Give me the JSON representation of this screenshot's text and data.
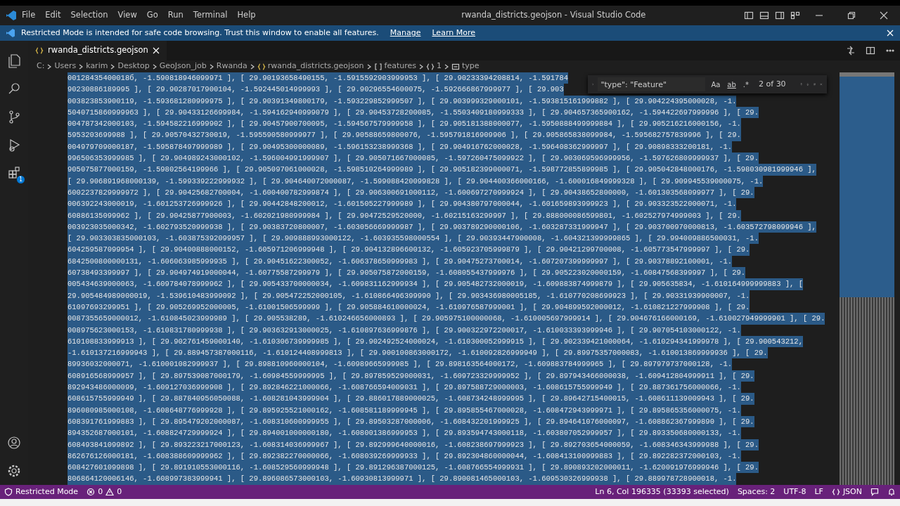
{
  "window": {
    "title": "rwanda_districts.geojson - Visual Studio Code"
  },
  "menu": [
    "File",
    "Edit",
    "Selection",
    "View",
    "Go",
    "Run",
    "Terminal",
    "Help"
  ],
  "banner": {
    "text": "Restricted Mode is intended for safe code browsing. Trust this window to enable all features.",
    "links": [
      "Manage",
      "Learn More"
    ]
  },
  "activity_bar": {
    "extensions_badge": "1"
  },
  "tabs": [
    {
      "label": "rwanda_districts.geojson",
      "selected": true
    }
  ],
  "breadcrumb": [
    {
      "label": "C:",
      "kind": "folder"
    },
    {
      "label": "Users",
      "kind": "folder"
    },
    {
      "label": "karim",
      "kind": "folder"
    },
    {
      "label": "Desktop",
      "kind": "folder"
    },
    {
      "label": "GeoJson_job",
      "kind": "folder"
    },
    {
      "label": "Rwanda",
      "kind": "folder"
    },
    {
      "label": "rwanda_districts.geojson",
      "kind": "file"
    },
    {
      "label": "features",
      "kind": "array"
    },
    {
      "label": "1",
      "kind": "object"
    },
    {
      "label": "type",
      "kind": "property"
    }
  ],
  "find": {
    "query": "\"type\": \"Feature\"",
    "options": [
      "Aa",
      "ab",
      ".*"
    ],
    "count": "2 of 30"
  },
  "editor": {
    "selected": true,
    "lines": [
      "00128435400018б, -1.590818946099971 ], [ 29.90193658490155, -1.5915592903999953 ], [ 29.90233394208814, -1.591784",
      "90230886189995 ], [ 29.90287017900104, -1.592445014999993 ], [ 29.90296554600075, -1.592666867999977 ], [ 29.903",
      "003823853900119, -1.593681280999975 ], [ 29.90391349800179, -1.593229852999507 ], [ 29.903999329000101, -1.593815161999882 ], [ 29.904224395000028, -1.",
      "5040715860999963 ], [ 29.90433126699984, -1.594162940999079 ], [ 29.90453728200085, -1.5503409180999333 ], [ 29.904657365900162, -1.594422697999996 ], [ 29.",
      "004787342000103, -1.594582216999902 ], [ 29.90457900700095, -1.594567579999958 ], [ 29.905181388000077, -1.5950888499999884 ], [ 29.905216216000156, -1.",
      "5953203699988 ], [ 29.90570432730019, -1.595590580999977 ], [ 29.90588659800076, -1.595791816909906 ], [ 29.905865838099984, -1.595682757839996 ], [ 29.",
      "004979709000187, -1.595878497999989 ], [ 29.90495300000089, -1.596153238999368 ], [ 29.904916762000028, -1.596408362999997 ], [ 29.90898333200181, -1.",
      "996506353999985 ], [ 29.904989243000102, -1.596004991999907 ], [ 29.905071667000085, -1.597260475099922 ], [ 29.903069596999956, -1.597626809999937 ], [ 29.",
      "905075877000159, -1.59802564199966 ], [ 29.905097061000028, -1.598510264999989 ], [ 29.905182399000071, -1.598772855899985 ], [ 29.905042848000176, -1.598030981999946 ],",
      "[ 29.906891968000139, -1.599339222999932 ], [ 29.904640072000087, -1.599088420099828 ], [ 29.904400366000166, -1.600016849999328 ], [ 29.909945539000075, -1.",
      "6002237829999972 ], [ 29.90425682700004, -1.600400782999874 ], [ 29.906300691000112, -1.600697270999924 ], [ 29.90438652800000, -1.601303568099977 ], [ 29.",
      "006392243000019, -1.601253726999926 ], [ 29.90442848200012, -1.601505227999989 ], [ 29.904380797000044, -1.601659893999923 ], [ 29.903323522000071, -1.",
      "60886135099962 ], [ 29.90425877900003, -1.602021980999984 ], [ 29.90472529520000, -1.60215163299997 ], [ 29.888000086599801, -1.602527974999003 ], [ 29.",
      "003923035000342, -1.602793520999938 ], [ 29.90383720800007, -1.603056669999987 ], [ 29.903789290000106, -1.603287331999947 ], [ 29.903700970000813, -1.603572798099946 ],",
      "[ 29.903303835000103, -1.603875392099957 ], [ 29.909888993000122, -1.603935598000554 ], [ 29.90393447900008, -1.604321399999865 ], [ 29.994009886500031, -1.",
      "604259587099954 ], [ 29.90400888000152, -1.605971206999948 ], [ 29.904132896600132, -1.605923705999879 ], [ 29.90421299700008, -1.605773547999997 ], [ 29.",
      "6842500800000131, -1.606063985999935 ], [ 29.90451622300052, -1.606378650999983 ], [ 29.90475273700014, -1.607207399999997 ], [ 29.90378892100001, -1.",
      "60738493399997 ], [ 29.904974919000044, -1.60775587299979 ], [ 29.905075872000159, -1.608055437999976 ], [ 29.905223020000159, -1.60847568399997 ], [ 29.",
      "005434639000063, -1.609784078999962 ], [ 29.905433700000034, -1.609831162999934 ], [ 29.905482732000019, -1.609883874999879 ], [ 29.905635834, -1.610164999999883 ], [",
      "29.905484989000019, -1.539610483999092 ], [ 29.905472252000105, -1.610866496399990 ], [ 29.903436980005185, -1.610770208699923 ], [ 29.90331939900007, -1.",
      "61097693299951 ], [ 29.905269952000005, -1.61001506599999 ], [ 29.905884610000024, -1.610976587999001 ], [ 29.904899592000012, -1.610821227999908 ], [ 29.",
      "0087355659000012, -1.610845023999989 ], [ 29.905538289, -1.610246656000893 ], [ 29.905975100000068, -1.610005697999914 ], [ 29.904676166000169, -1.610027949999901 ], [ 29.",
      "008975623000153, -1.610831780999938 ], [ 29.903632913000025, -1.610897636999876 ], [ 29.900322972200017, -1.610033393999946 ], [ 29.907054103000122, -1.",
      "610108833999913 ], [ 29.902761459000140, -1.610306739999985 ], [ 29.902492524000024, -1.610300052999915 ], [ 29.902339421000064, -1.610294341999978 ], [ 29.900543212,",
      "-1.610137216999943 ], [ 29.889457387000116, -1.610124408999813 ], [ 29.900100863000172, -1.610092826999949 ], [ 29.89975357000083, -1.610013869999936 ], [ 29.",
      "89936032000071, -1.610001082999937 ], [ 29.898810960000104, -1.60989665999985 ], [ 29.898163564000172, -1.609883784999965 ], [ 29.897979737000128, -1.",
      "608916568999957 ], [ 29.897539087000179, -1.60984559999995 ], [ 29.897859529000031, -1.609723329999952 ], [ 29.897943466000038, -1.609412804999911 ], [ 29.",
      "892943486000099, -1.609127036999908 ], [ 29.892846221000066, -1.608766594009031 ], [ 29.897588729000003, -1.608615755999949 ], [ 29.887361756000066, -1.",
      "608615755999949 ], [ 29.887840956050088, -1.608281043999904 ], [ 29.886017889000025, -1.608734248999995 ], [ 29.89642715400015, -1.608611139009943 ], [ 29.",
      "896080985000108, -1.608648776999928 ], [ 29.895925521000162, -1.608581189999945 ], [ 29.895855467000028, -1.608472943999971 ], [ 29.895865356000075, -1.",
      "608391761999883 ], [ 29.895479202000087, -1.608310600999955 ], [ 29.89503287000006, -1.608432201999925 ], [ 29.894641076000097, -1.608862367999890 ], [ 29.",
      "894352687000101, -1.608824729999924 ], [ 29.894001000000180, -1.608001386999953 ], [ 29.893594743000118, -1.603807052999957 ], [ 29.893350680000133, -1.",
      "608493841099892 ], [ 29.893223217000123, -1.608314036999967 ], [ 29.892999640000016, -1.608238697999923 ], [ 29.892703654000059, -1.608346343999988 ], [ 29.",
      "862676126000181, -1.608388609999962 ], [ 29.892382270000066, -1.608039269999933 ], [ 29.892304860000044, -1.608413100999883 ], [ 29.892282372000103, -1.",
      "608427601099898 ], [ 29.891910553000116, -1.608529560999948 ], [ 29.891296387000125, -1.608766554999931 ], [ 29.890893202000011, -1.620091976999946 ], [ 29.",
      "806864120006146, -1.608997383999941 ], [ 29.896086573000103, -1.60930813999971 ], [ 29.890081465000103, -1.609530326999938 ], [ 29.889978728900018, -1."
    ]
  },
  "status_bar": {
    "mode": "Restricted Mode",
    "errors": "0",
    "warnings": "0",
    "position": "Ln 6, Col 196335 (33393 selected)",
    "indent": "Spaces: 2",
    "encoding": "UTF-8",
    "eol": "LF",
    "language": "JSON"
  }
}
